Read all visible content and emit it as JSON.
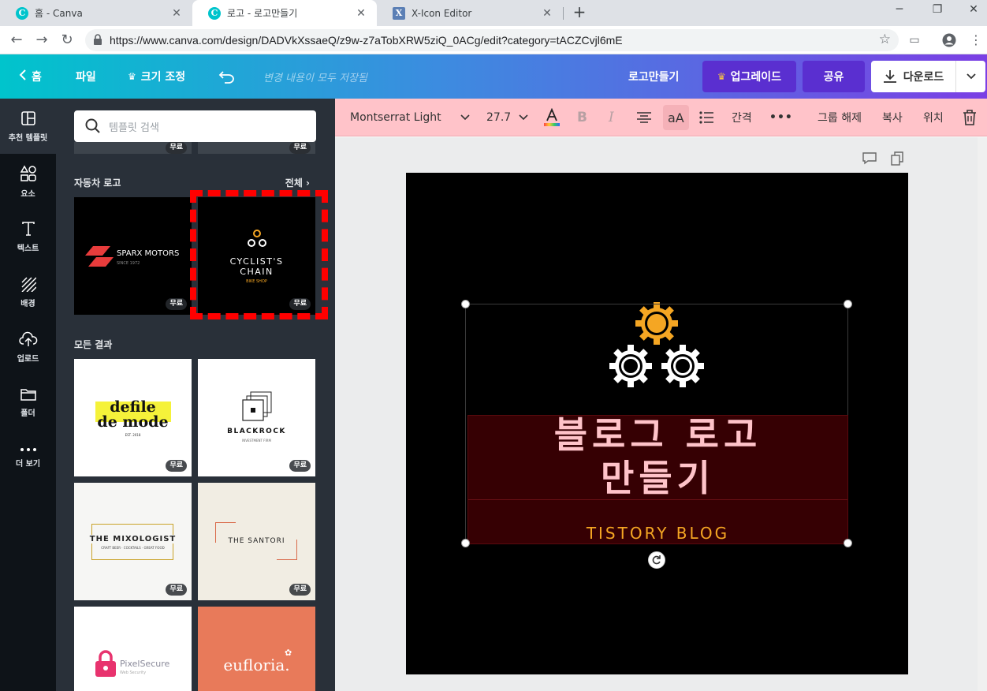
{
  "browser": {
    "tabs": [
      {
        "title": "홈 - Canva",
        "icon": "canva-icon",
        "favicon_letter": "C"
      },
      {
        "title": "로고 - 로고만들기",
        "icon": "canva-icon",
        "favicon_letter": "C",
        "active": true
      },
      {
        "title": "X-Icon Editor",
        "icon": "xicon-icon",
        "favicon_letter": "X"
      }
    ],
    "url": "https://www.canva.com/design/DADVkXssaeQ/z9w-z7aTobXRW5ziQ_0ACg/edit?category=tACZCvjl6mE"
  },
  "header": {
    "home": "홈",
    "file": "파일",
    "resize": "크기 조정",
    "saved_status": "변경 내용이 모두 저장됨",
    "design_title": "로고만들기",
    "upgrade": "업그레이드",
    "share": "공유",
    "download": "다운로드"
  },
  "rail": [
    {
      "label": "추천 템플릿",
      "icon": "template-icon"
    },
    {
      "label": "요소",
      "icon": "elements-icon"
    },
    {
      "label": "텍스트",
      "icon": "text-icon"
    },
    {
      "label": "배경",
      "icon": "background-icon"
    },
    {
      "label": "업로드",
      "icon": "upload-icon"
    },
    {
      "label": "폴더",
      "icon": "folder-icon"
    },
    {
      "label": "더 보기",
      "icon": "more-icon"
    }
  ],
  "panel": {
    "search_placeholder": "템플릿 검색",
    "free_badge": "무료",
    "section_car": "자동차 로고",
    "see_all": "전체",
    "section_all": "모든 결과",
    "templates": {
      "sparx": {
        "name": "SPARX MOTORS",
        "sub": "SINCE 1972"
      },
      "cyclist": {
        "line1": "CYCLIST'S",
        "line2": "CHAIN",
        "sub": "BIKE SHOP"
      },
      "defile": {
        "line1": "defile",
        "line2": "de mode",
        "sub": "EST. 2018"
      },
      "blackrock": {
        "name": "BLACKROCK",
        "sub": "INVESTMENT FIRM"
      },
      "mixologist": {
        "name": "THE MIXOLOGIST",
        "sub": "CRAFT BEER · COCKTAILS · GREAT FOOD"
      },
      "santori": {
        "name": "THE SANTORI"
      },
      "pixelsecure": {
        "name": "PixelSecure",
        "sub": "Web Security"
      },
      "eufloria": {
        "name": "eufloria."
      }
    }
  },
  "toolbar": {
    "font": "Montserrat Light",
    "size": "27.7",
    "bold": "B",
    "italic": "I",
    "case": "aA",
    "spacing": "간격",
    "more": "•••",
    "ungroup": "그룹 해제",
    "copy": "복사",
    "position": "위치"
  },
  "canvas": {
    "headline_line1": "블로그 로고",
    "headline_line2": "만들기",
    "subline": "TISTORY BLOG"
  },
  "colors": {
    "canva_teal": "#00c4cc",
    "canva_purple": "#7b3fe4",
    "toolbar_pink": "#ffc3c9",
    "headline_pink": "#ffc3c9",
    "subline_orange": "#f5a623",
    "text_box_bg": "#360003"
  }
}
